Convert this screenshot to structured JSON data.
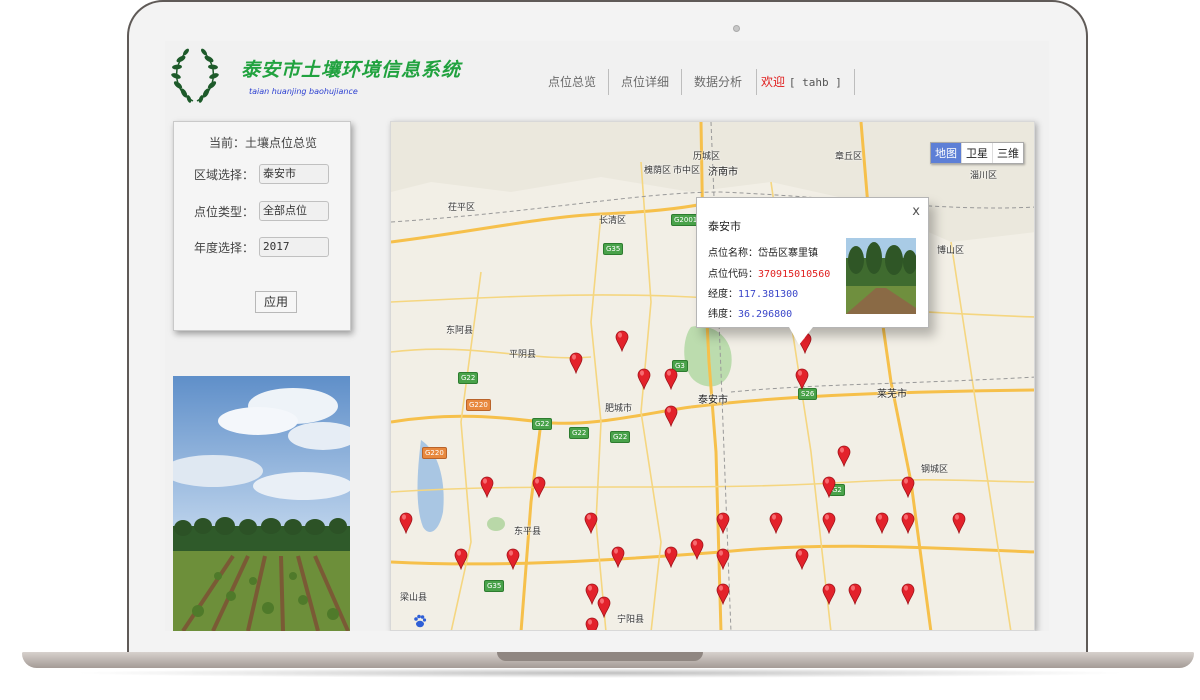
{
  "header": {
    "title_cn": "泰安市土壤环境信息系统",
    "title_en": "taian huanjing baohujiance",
    "nav": [
      "点位总览",
      "点位详细",
      "数据分析"
    ],
    "welcome": "欢迎",
    "user": "[ tahb ]"
  },
  "filter": {
    "title": "当前：土壤点位总览",
    "region_label": "区域选择：",
    "region_value": "泰安市",
    "type_label": "点位类型：",
    "type_value": "全部点位",
    "year_label": "年度选择：",
    "year_value": "2017",
    "apply": "应用"
  },
  "map": {
    "type_buttons": [
      "地图",
      "卫星",
      "三维"
    ],
    "active_type": "地图",
    "labels": {
      "licheng": "历城区",
      "huaiyin": "槐荫区",
      "shizhong": "市中区",
      "jinan": "济南市",
      "zhangqiu": "章丘区",
      "zichuan": "淄川区",
      "chiping": "茌平区",
      "changqing": "长清区",
      "boshan": "博山区",
      "donga": "东阿县",
      "pingyin": "平阴县",
      "feicheng": "肥城市",
      "taian": "泰安市",
      "laiwu": "莱芜市",
      "gangcheng": "钢城区",
      "dongping": "东平县",
      "liangshan": "梁山县",
      "ningyang": "宁阳县"
    },
    "highways": {
      "g2001": "G2001",
      "g35": "G35",
      "g3": "G3",
      "g22": "G22",
      "g220": "G220",
      "s26": "S26",
      "g2": "G2"
    },
    "baidu_logo": "du"
  },
  "popup": {
    "title": "泰安市",
    "name_label": "点位名称：",
    "name_value": "岱岳区寨里镇",
    "code_label": "点位代码：",
    "code_value": "370915010560",
    "lng_label": "经度：",
    "lng_value": "117.381300",
    "lat_label": "纬度：",
    "lat_value": "36.296800",
    "close": "x"
  },
  "colors": {
    "title_green": "#21a23f",
    "pin_red": "#e3222b",
    "active_blue": "#5d7fd6",
    "code_red": "#e02020",
    "coord_blue": "#3a46c9"
  }
}
